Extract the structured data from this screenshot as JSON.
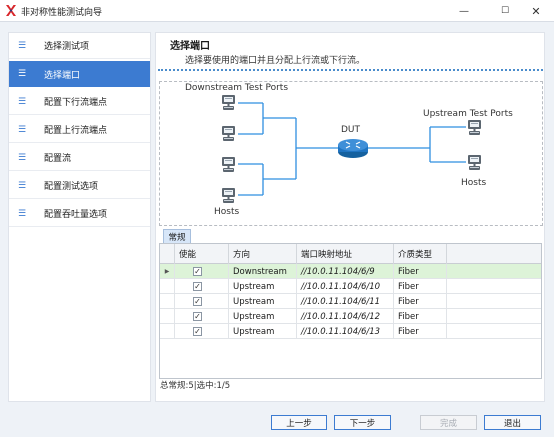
{
  "window": {
    "title": "非对称性能测试向导",
    "controls": {
      "minimize": "—",
      "maximize": "☐",
      "close": "✕"
    }
  },
  "sidebar": {
    "items": [
      {
        "label": "选择测试项",
        "icon": "list-icon",
        "active": false
      },
      {
        "label": "选择端口",
        "icon": "list-icon",
        "active": true
      },
      {
        "label": "配置下行流端点",
        "icon": "list-icon",
        "active": false
      },
      {
        "label": "配置上行流端点",
        "icon": "list-icon",
        "active": false
      },
      {
        "label": "配置流",
        "icon": "list-icon",
        "active": false
      },
      {
        "label": "配置测试选项",
        "icon": "list-icon",
        "active": false
      },
      {
        "label": "配置吞吐量选项",
        "icon": "list-icon",
        "active": false
      }
    ]
  },
  "main": {
    "title": "选择端口",
    "subtitle": "选择要使用的端口并且分配上行流或下行流。",
    "topology": {
      "downstream_label": "Downstream Test Ports",
      "upstream_label": "Upstream Test Ports",
      "dut_label": "DUT",
      "hosts_left": "Hosts",
      "hosts_right": "Hosts"
    },
    "tab": "常规",
    "grid": {
      "columns": [
        "使能",
        "方向",
        "端口映射地址",
        "介质类型"
      ],
      "rows": [
        {
          "enabled": true,
          "direction": "Downstream",
          "port": "//10.0.11.104/6/9",
          "media": "Fiber",
          "selected": true
        },
        {
          "enabled": true,
          "direction": "Upstream",
          "port": "//10.0.11.104/6/10",
          "media": "Fiber",
          "selected": false
        },
        {
          "enabled": true,
          "direction": "Upstream",
          "port": "//10.0.11.104/6/11",
          "media": "Fiber",
          "selected": false
        },
        {
          "enabled": true,
          "direction": "Upstream",
          "port": "//10.0.11.104/6/12",
          "media": "Fiber",
          "selected": false
        },
        {
          "enabled": true,
          "direction": "Upstream",
          "port": "//10.0.11.104/6/13",
          "media": "Fiber",
          "selected": false
        }
      ]
    },
    "status": "总常规:5|选中:1/5"
  },
  "footer": {
    "prev": "上一步",
    "next": "下一步",
    "finish": "完成",
    "exit": "退出"
  },
  "colors": {
    "accent": "#3c7bd1",
    "selected_row": "#ddf3d8",
    "logo_red": "#d9262a",
    "link_line": "#2f8fe0",
    "router": "#1f74c2"
  }
}
